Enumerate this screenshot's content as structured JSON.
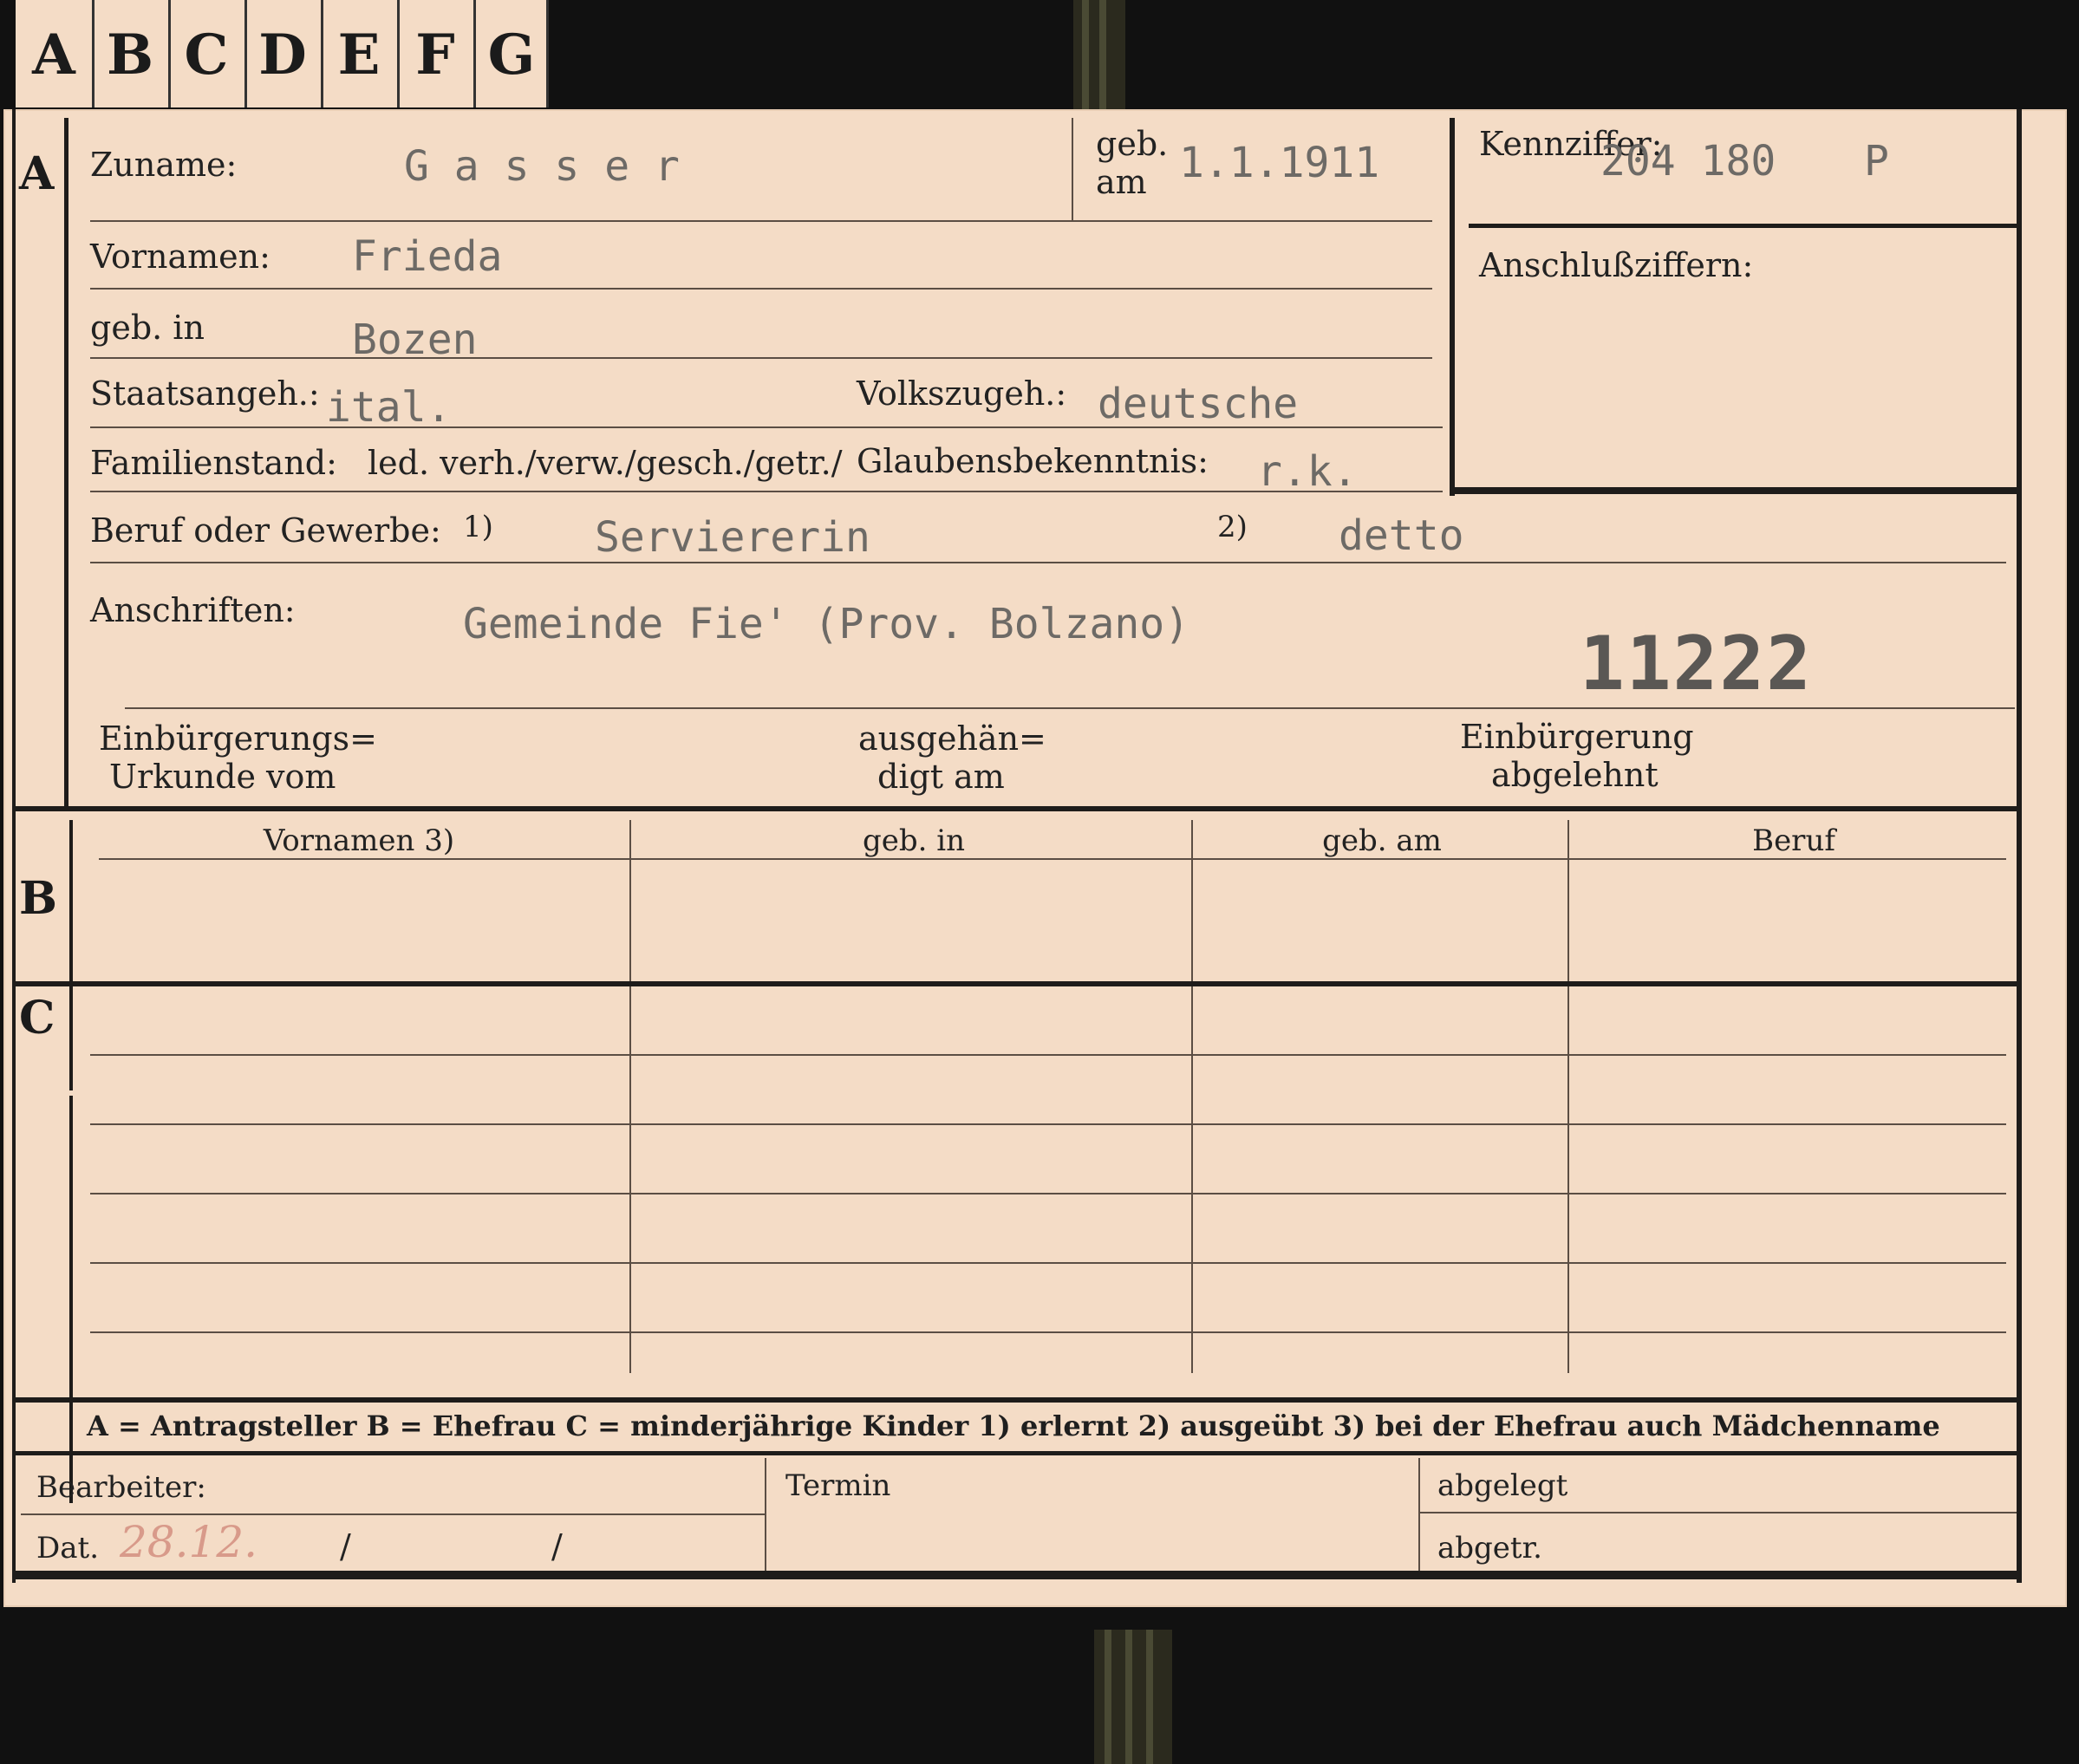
{
  "tabs": [
    "A",
    "B",
    "C",
    "D",
    "E",
    "F",
    "G"
  ],
  "sections": {
    "a": "A",
    "b": "B",
    "c": "C"
  },
  "form": {
    "zuname_label": "Zuname:",
    "zuname_value": "G a s s e r",
    "geb_am_label_1": "geb.",
    "geb_am_label_2": "am",
    "geb_am_value": "1.1.1911",
    "kennziffer_label": "Kennziffer:",
    "kennziffer_value": "204 180",
    "kennziffer_letter": "P",
    "anschluss_label": "Anschlußziffern:",
    "vornamen_label": "Vornamen:",
    "vornamen_value": "Frieda",
    "geb_in_label": "geb. in",
    "geb_in_value": "Bozen",
    "staats_label": "Staatsangeh.:",
    "staats_value": "ital.",
    "volks_label": "Volkszugeh.:",
    "volks_value": "deutsche",
    "familien_label": "Familienstand:",
    "familien_options": "led. verh./verw./gesch./getr./",
    "glaubens_label": "Glaubensbekenntnis:",
    "glaubens_value": "r.k.",
    "beruf_label": "Beruf oder Gewerbe:",
    "beruf_note1": "1)",
    "beruf_value1": "Serviererin",
    "beruf_note2": "2)",
    "beruf_value2": "detto",
    "anschriften_label": "Anschriften:",
    "anschriften_value": "Gemeinde Fie' (Prov. Bolzano)",
    "stamp_number": "11222",
    "einb_urkunde_1": "Einbürgerungs=",
    "einb_urkunde_2": "Urkunde vom",
    "ausgeh_1": "ausgehän=",
    "ausgeh_2": "digt am",
    "einb_abgelehnt_1": "Einbürgerung",
    "einb_abgelehnt_2": "abgelehnt"
  },
  "table_b": {
    "headers": [
      "Vornamen 3)",
      "geb. in",
      "geb. am",
      "Beruf"
    ]
  },
  "legend": "A = Antragsteller   B = Ehefrau   C = minderjährige Kinder   1) erlernt   2) ausgeübt   3) bei der Ehefrau auch Mädchenname",
  "footer": {
    "bearbeiter": "Bearbeiter:",
    "dat": "Dat.",
    "dat_hand": "28.12.",
    "slash1": "/",
    "slash2": "/",
    "termin": "Termin",
    "abgelegt": "abgelegt",
    "abgetr": "abgetr."
  }
}
